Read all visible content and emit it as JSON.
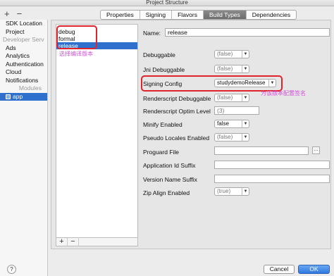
{
  "window": {
    "title": "Project Structure"
  },
  "left_toolbar": {
    "add": "+",
    "remove": "−"
  },
  "sidebar": {
    "items": [
      "SDK Location",
      "Project"
    ],
    "developer_section": "Developer Serv",
    "dev_items": [
      "Ads",
      "Analytics",
      "Authentication",
      "Cloud",
      "Notifications"
    ],
    "modules_header": "Modules",
    "module_app": "app"
  },
  "tabs": [
    "Properties",
    "Signing",
    "Flavors",
    "Build Types",
    "Dependencies"
  ],
  "build_types": [
    "debug",
    "formal",
    "release"
  ],
  "annotations": {
    "select_version": "选择编译版本",
    "signing_note": "为该版本配置签名"
  },
  "form": {
    "name_label": "Name:",
    "name_value": "release",
    "debuggable_label": "Debuggable",
    "debuggable_value": "(false)",
    "jni_label": "Jni Debuggable",
    "jni_value": "(false)",
    "signing_label": "Signing Config",
    "signing_value": "studydemoRelease",
    "rs_debug_label": "Renderscript Debuggable",
    "rs_debug_value": "(false)",
    "rs_optim_label": "Renderscript Optim Level",
    "rs_optim_value": "(3)",
    "minify_label": "Minify Enabled",
    "minify_value": "false",
    "pseudo_label": "Pseudo Locales Enabled",
    "pseudo_value": "(false)",
    "proguard_label": "Proguard File",
    "proguard_browse": "...",
    "app_id_label": "Application Id Suffix",
    "version_name_label": "Version Name Suffix",
    "zip_label": "Zip Align Enabled",
    "zip_value": "(true)"
  },
  "list_footer": {
    "add": "+",
    "remove": "−"
  },
  "footer": {
    "help": "?",
    "cancel": "Cancel",
    "ok": "OK"
  },
  "colors": {
    "selection": "#2f6fce",
    "highlight_box": "#e0242c",
    "annotation": "#d34fd7"
  }
}
